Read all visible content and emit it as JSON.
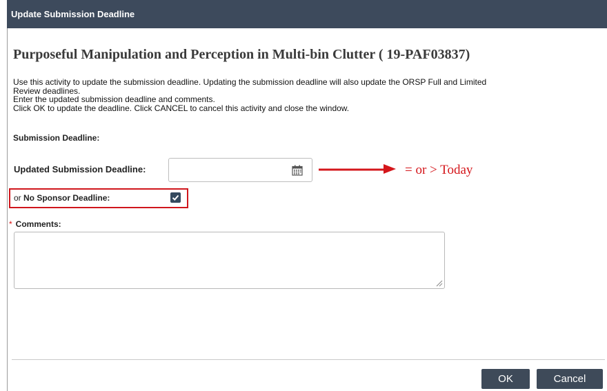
{
  "window": {
    "title": "Update Submission Deadline"
  },
  "heading": "Purposeful Manipulation and Perception in Multi-bin Clutter ( 19-PAF03837)",
  "instructions": [
    "Use this activity to update the submission deadline. Updating the submission deadline will also update the ORSP Full and Limited",
    "Review deadlines.",
    "Enter the updated submission deadline and comments.",
    "Click OK to update the deadline. Click CANCEL to cancel this activity and close the window."
  ],
  "form": {
    "section_label": "Submission Deadline:",
    "updated_deadline_label": "Updated Submission Deadline:",
    "updated_deadline_value": "",
    "no_sponsor_prefix": "or",
    "no_sponsor_label": "No Sponsor Deadline:",
    "no_sponsor_checked": true,
    "comments_required_marker": "*",
    "comments_label": "Comments:",
    "comments_value": ""
  },
  "annotation": {
    "text": "= or > Today",
    "color": "#d4161b"
  },
  "buttons": {
    "ok": "OK",
    "cancel": "Cancel"
  },
  "colors": {
    "titlebar": "#3d4a5c",
    "button": "#3e4a59",
    "highlight": "#d0161c",
    "checkbox": "#34495e"
  },
  "icons": {
    "date_picker": "calendar-icon",
    "checkbox_mark": "check-icon",
    "resize": "resize-grip-icon"
  }
}
